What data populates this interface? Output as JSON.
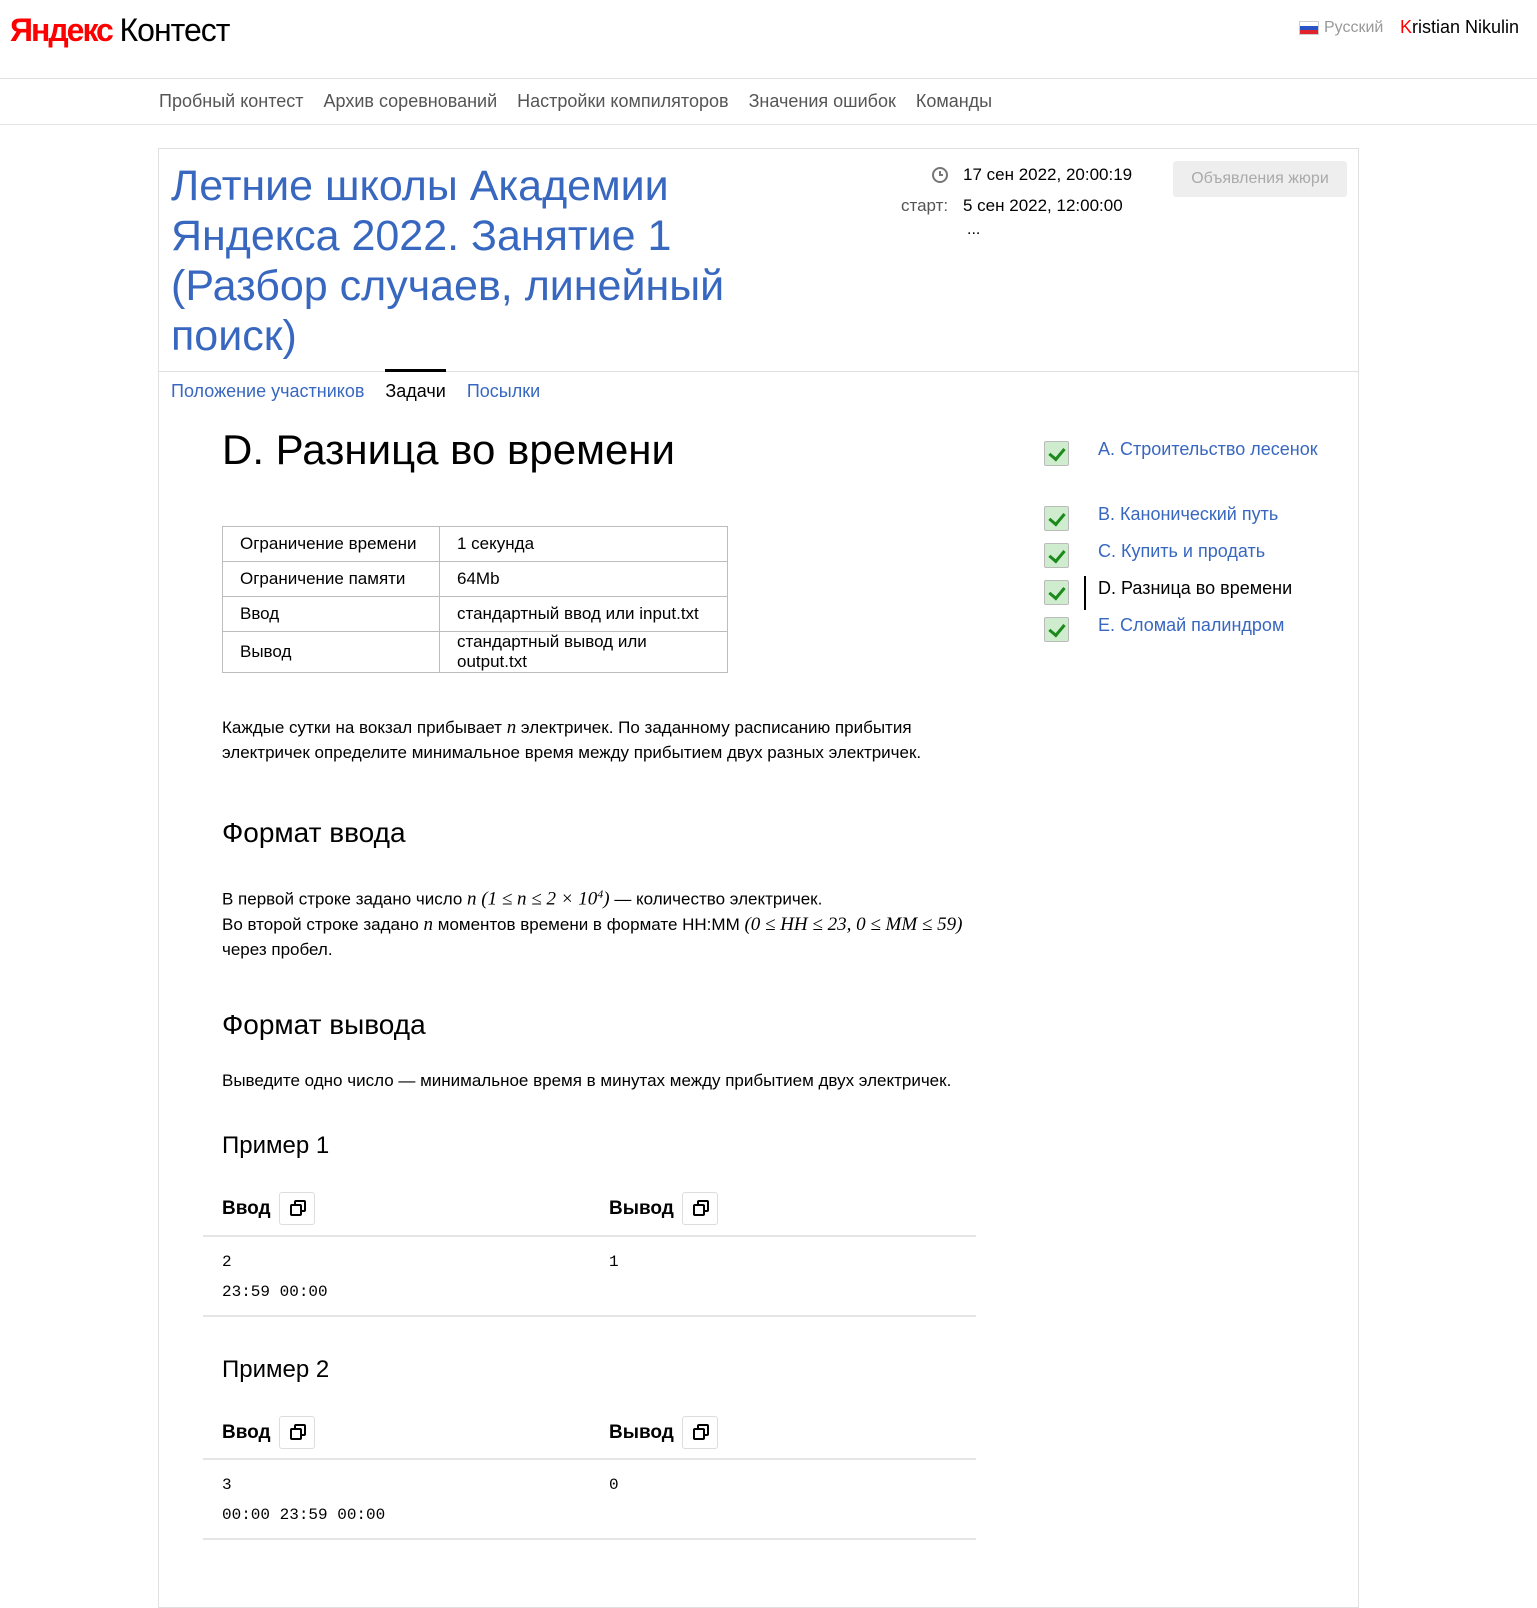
{
  "header": {
    "logo_ya": "Яндекс",
    "logo_kontest": "Контест",
    "language": "Русский",
    "user_first_letter": "K",
    "user_rest": "ristian Nikulin"
  },
  "nav": {
    "items": [
      "Пробный контест",
      "Архив соревнований",
      "Настройки компиляторов",
      "Значения ошибок",
      "Команды"
    ]
  },
  "contest": {
    "title": "Летние школы Академии Яндекса 2022. Занятие 1 (Разбор случаев, линейный поиск)",
    "now": "17 сен 2022, 20:00:19",
    "start_label": "старт:",
    "start": "5 сен 2022, 12:00:00",
    "ellipsis": "...",
    "jury_button": "Объявления жюри",
    "tabs": [
      "Положение участников",
      "Задачи",
      "Посылки"
    ],
    "active_tab": "Задачи"
  },
  "problem": {
    "title": "D. Разница во времени",
    "limits": [
      {
        "name": "Ограничение времени",
        "value": "1 секунда"
      },
      {
        "name": "Ограничение памяти",
        "value": "64Mb"
      },
      {
        "name": "Ввод",
        "value": "стандартный ввод или input.txt"
      },
      {
        "name": "Вывод",
        "value": "стандартный вывод или output.txt"
      }
    ],
    "statement_part1": "Каждые сутки на вокзал прибывает ",
    "statement_var": "n",
    "statement_part2": " электричек. По заданному расписанию прибытия электричек определите минимальное время между прибытием двух разных электричек.",
    "input_heading": "Формат ввода",
    "input_l1_a": "В первой строке задано число ",
    "input_l1_var": "n",
    "input_l1_math_a": "(1 ≤ n ≤ 2 × 10",
    "input_l1_exp": "4",
    "input_l1_math_b": ")",
    "input_l1_b": " — количество электричек.",
    "input_l2_a": "Во второй строке задано ",
    "input_l2_var": "n",
    "input_l2_b": " моментов времени в формате HH:MM ",
    "input_l2_math": "(0 ≤ HH ≤ 23, 0 ≤ MM ≤ 59)",
    "input_l3": "через пробел.",
    "output_heading": "Формат вывода",
    "output_text": "Выведите одно число — минимальное время в минутах между прибытием двух электричек.",
    "examples": [
      {
        "title": "Пример 1",
        "input_label": "Ввод",
        "output_label": "Вывод",
        "input": "2\n23:59 00:00",
        "output": "1"
      },
      {
        "title": "Пример 2",
        "input_label": "Ввод",
        "output_label": "Вывод",
        "input": "3\n00:00 23:59 00:00",
        "output": "0"
      }
    ]
  },
  "task_list": [
    {
      "label": "A. Строительство лесенок",
      "solved": true,
      "current": false
    },
    {
      "label": "B. Канонический путь",
      "solved": true,
      "current": false
    },
    {
      "label": "C. Купить и продать",
      "solved": true,
      "current": false
    },
    {
      "label": "D. Разница во времени",
      "solved": true,
      "current": true
    },
    {
      "label": "E. Сломай палиндром",
      "solved": true,
      "current": false
    }
  ],
  "colors": {
    "link": "#3867c0",
    "brand_red": "#ff0000",
    "solved_green": "#1b8a1b"
  }
}
